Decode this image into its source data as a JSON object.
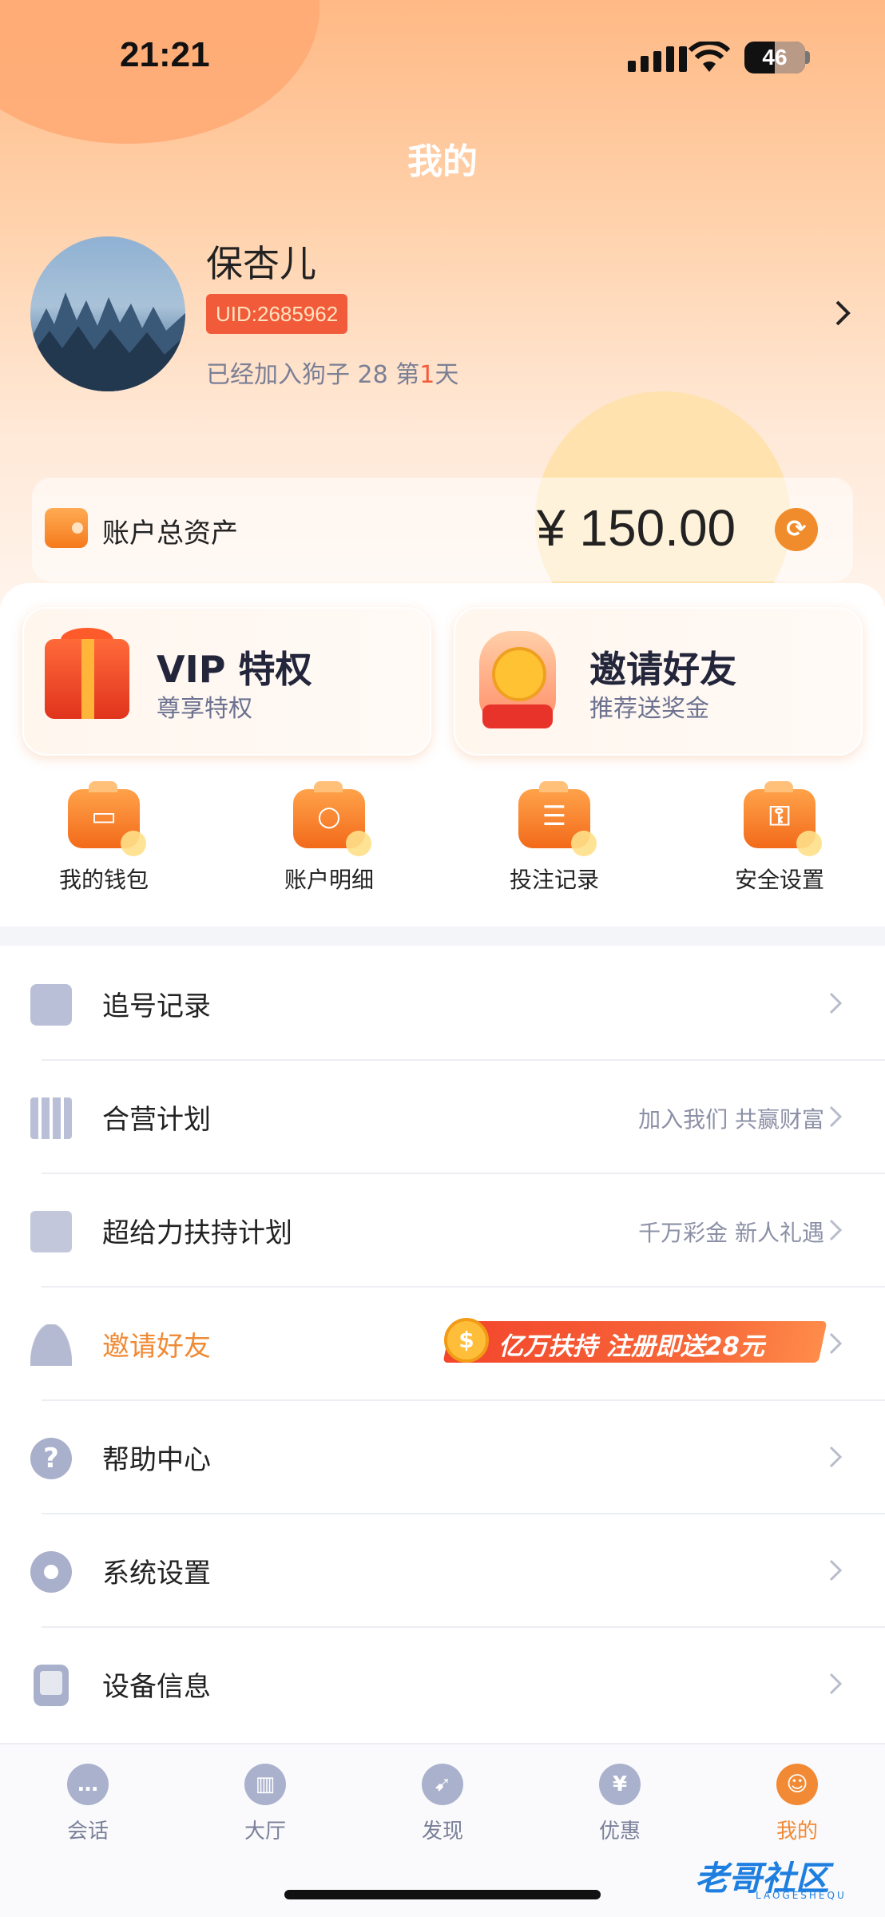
{
  "status_bar": {
    "time": "21:21",
    "battery": "46"
  },
  "header": {
    "title": "我的"
  },
  "profile": {
    "name": "保杏儿",
    "uid": "UID:2685962",
    "join_prefix": "已经加入狗子 28 第",
    "join_days": "1",
    "join_suffix": "天"
  },
  "assets": {
    "label": "账户总资产",
    "value": "¥ 150.00"
  },
  "promos": [
    {
      "title": "VIP 特权",
      "subtitle": "尊享特权"
    },
    {
      "title": "邀请好友",
      "subtitle": "推荐送奖金"
    }
  ],
  "quick_actions": [
    {
      "label": "我的钱包",
      "icon": "wallet-icon"
    },
    {
      "label": "账户明细",
      "icon": "search-icon"
    },
    {
      "label": "投注记录",
      "icon": "record-icon"
    },
    {
      "label": "安全设置",
      "icon": "key-icon"
    }
  ],
  "menu": [
    {
      "label": "追号记录",
      "right": "",
      "icon": "document-icon"
    },
    {
      "label": "合营计划",
      "right": "加入我们 共赢财富",
      "icon": "qr-code-icon"
    },
    {
      "label": "超给力扶持计划",
      "right": "千万彩金 新人礼遇",
      "icon": "gift-icon"
    },
    {
      "label": "邀请好友",
      "right": "",
      "icon": "user-icon",
      "banner": "亿万扶持 注册即送28元"
    },
    {
      "label": "帮助中心",
      "right": "",
      "icon": "help-icon"
    },
    {
      "label": "系统设置",
      "right": "",
      "icon": "gear-icon"
    },
    {
      "label": "设备信息",
      "right": "",
      "icon": "device-icon"
    }
  ],
  "tabs": [
    {
      "label": "会话",
      "icon": "chat-icon",
      "active": false
    },
    {
      "label": "大厅",
      "icon": "hall-icon",
      "active": false
    },
    {
      "label": "发现",
      "icon": "compass-icon",
      "active": false
    },
    {
      "label": "优惠",
      "icon": "coupon-icon",
      "active": false
    },
    {
      "label": "我的",
      "icon": "profile-icon",
      "active": true
    }
  ],
  "watermark": {
    "text": "老哥社区",
    "sub": "LAOGESHEQU"
  },
  "colors": {
    "accent": "#f28a35",
    "uid_badge": "#f25b3a",
    "inactive_icon": "#aab1cd"
  }
}
